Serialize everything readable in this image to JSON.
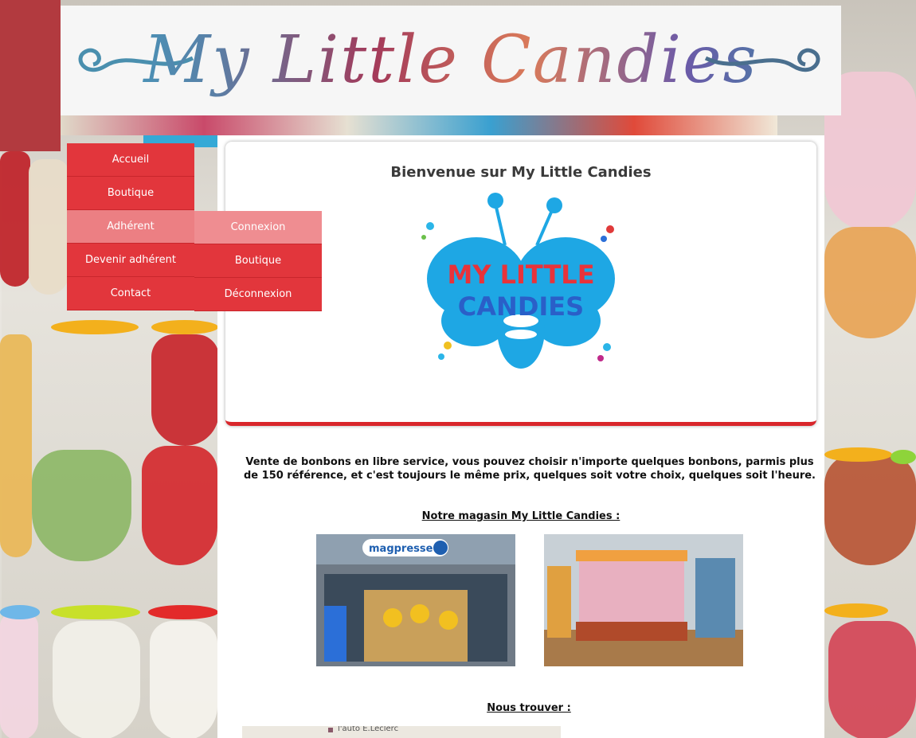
{
  "banner": {
    "title": "My Little Candies"
  },
  "nav": {
    "items": [
      {
        "label": "Accueil"
      },
      {
        "label": "Boutique"
      },
      {
        "label": "Adhérent"
      },
      {
        "label": "Devenir adhérent"
      },
      {
        "label": "Contact"
      }
    ],
    "submenu": [
      {
        "label": "Connexion"
      },
      {
        "label": "Boutique"
      },
      {
        "label": "Déconnexion"
      }
    ]
  },
  "welcome": {
    "title": "Bienvenue sur My Little Candies",
    "logo_line1": "MY LITTLE",
    "logo_line2": "CANDIES"
  },
  "description": "Vente de bonbons en libre service, vous pouvez choisir n'importe quelques bonbons, parmis plus de 150 référence, et c'est toujours le même prix, quelques soit votre choix, quelques soit l'heure.",
  "store": {
    "heading": "Notre magasin My Little Candies :",
    "sign_text": "magpresse"
  },
  "location": {
    "heading": "Nous trouver :",
    "map_label": "l'auto E.Leclerc"
  },
  "colors": {
    "menu_red": "#e2363c",
    "menu_active": "#ec7f83",
    "accent_border": "#d9262b"
  }
}
